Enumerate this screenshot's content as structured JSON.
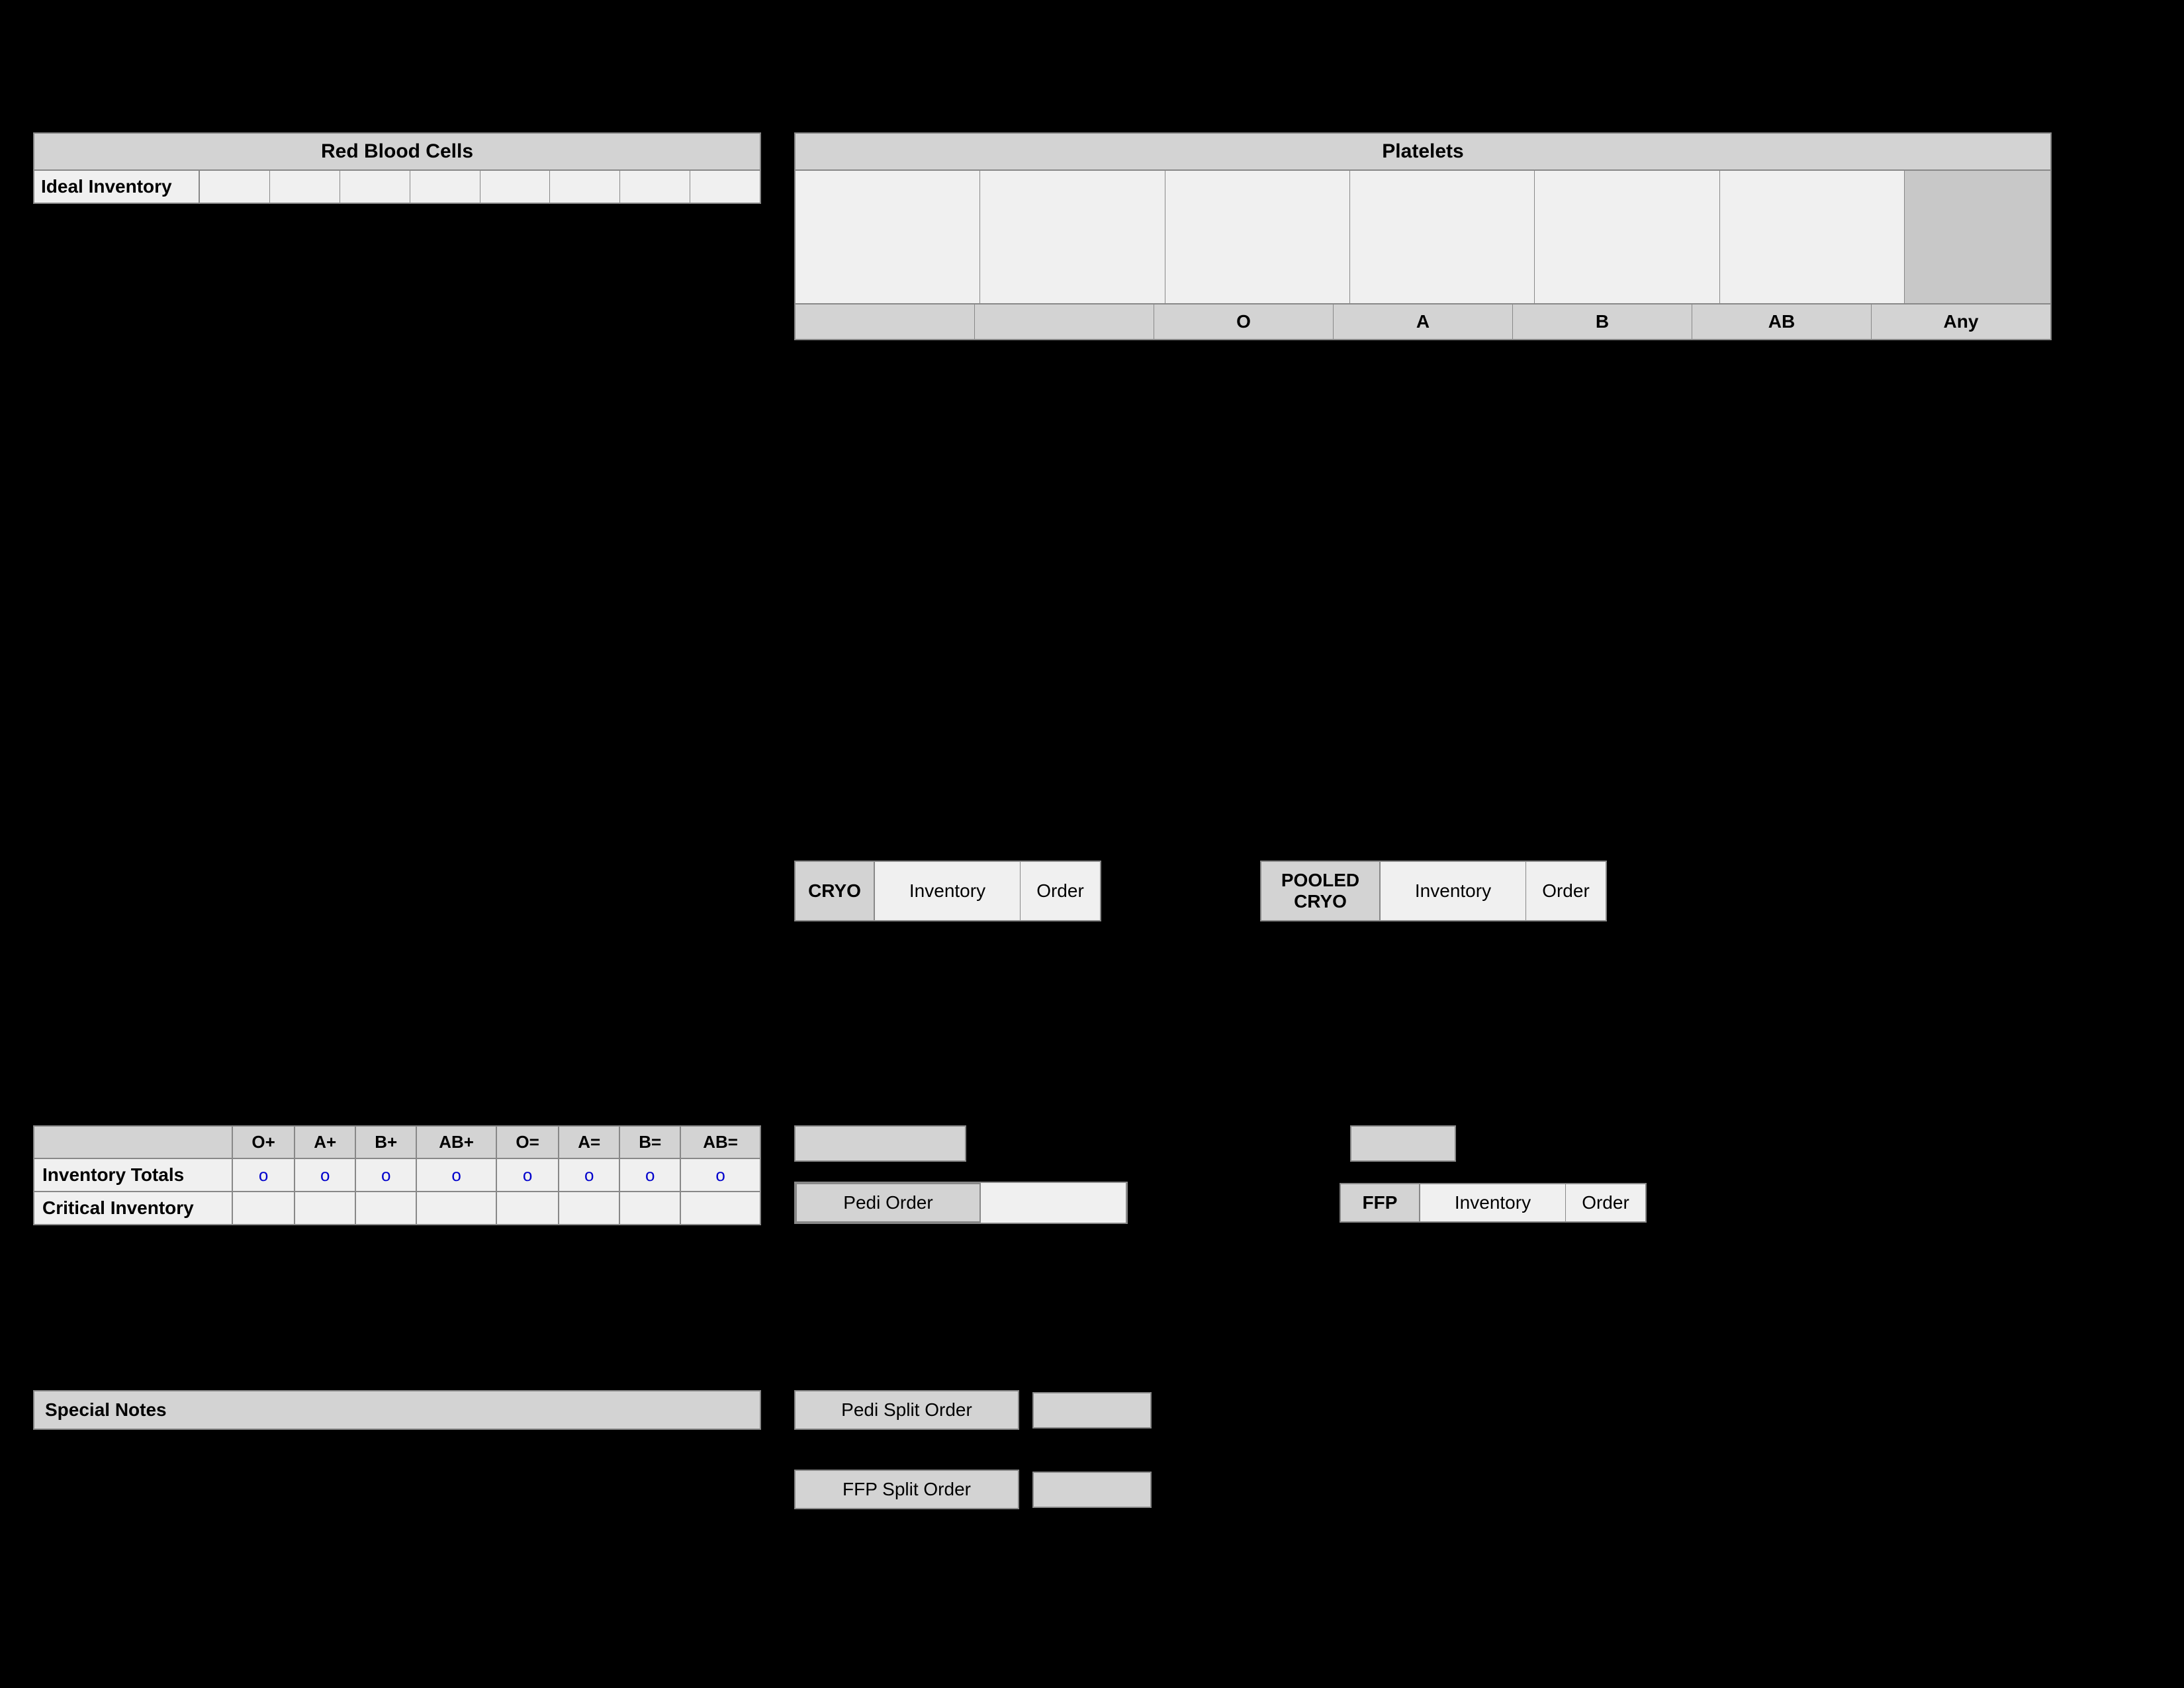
{
  "rbc": {
    "header": "Red Blood Cells",
    "ideal_inventory_label": "Ideal Inventory",
    "cells": [
      "",
      "",
      "",
      "",
      "",
      "",
      "",
      "",
      "",
      ""
    ]
  },
  "platelets": {
    "header": "Platelets",
    "top_cells": [
      "",
      "",
      "",
      "",
      "",
      "",
      "",
      "",
      "",
      "",
      "gray"
    ],
    "bottom_labels": [
      "",
      "",
      "O",
      "A",
      "B",
      "AB",
      "Any"
    ]
  },
  "cryo": {
    "label": "CRYO",
    "inventory_label": "Inventory",
    "order_label": "Order"
  },
  "pooled_cryo": {
    "label": "POOLED\nCRYO",
    "inventory_label": "Inventory",
    "order_label": "Order"
  },
  "inv_totals": {
    "columns": [
      "",
      "O+",
      "A+",
      "B+",
      "AB+",
      "O=",
      "A=",
      "B=",
      "AB="
    ],
    "rows": [
      {
        "label": "Inventory Totals",
        "values": [
          "o",
          "o",
          "o",
          "o",
          "o",
          "o",
          "o",
          "o"
        ]
      },
      {
        "label": "Critical Inventory",
        "values": [
          "",
          "",
          "",
          "",
          "",
          "",
          "",
          ""
        ]
      }
    ]
  },
  "pedi_order": {
    "standalone_input": "",
    "label": "Pedi Order",
    "inventory": "",
    "order": ""
  },
  "ffp": {
    "standalone_input": "",
    "label": "FFP",
    "inventory_label": "Inventory",
    "order_label": "Order"
  },
  "special_notes": {
    "label": "Special Notes"
  },
  "pedi_split_order": {
    "label": "Pedi Split Order",
    "input": ""
  },
  "ffp_split_order": {
    "label": "FFP Split Order",
    "input": ""
  }
}
